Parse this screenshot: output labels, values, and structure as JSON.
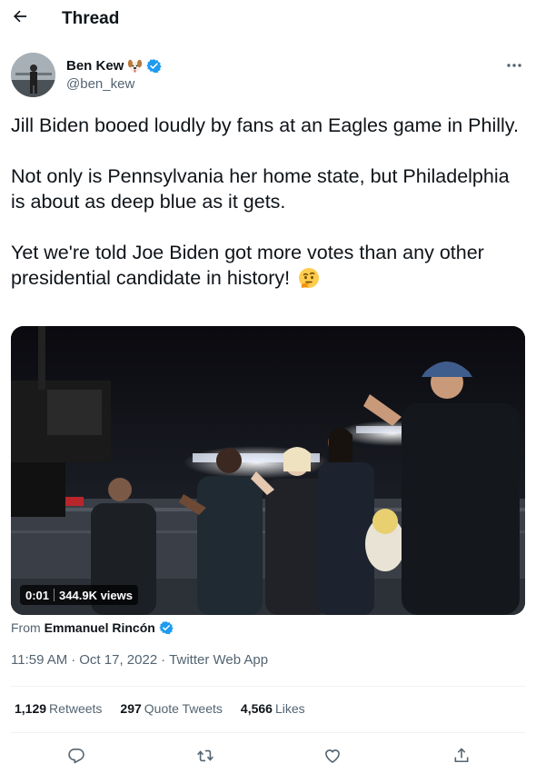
{
  "header": {
    "title": "Thread",
    "back_icon": "arrow-left-icon"
  },
  "author": {
    "name": "Ben Kew",
    "name_emoji": "dog-face-emoji",
    "verified_icon": "verified-badge-icon",
    "handle": "@ben_kew",
    "more_icon": "more-options-icon"
  },
  "tweet": {
    "paragraphs": [
      "Jill Biden booed loudly by fans at an Eagles game in Philly.",
      "Not only is Pennsylvania her home state, but Philadelphia is about as deep blue as it gets.",
      "Yet we're told Joe Biden got more votes than any other presidential candidate in history!"
    ],
    "trailing_emoji": "thinking-face-emoji"
  },
  "media": {
    "type": "video",
    "time": "0:01",
    "views": "344.9K views"
  },
  "attribution": {
    "prefix": "From",
    "name": "Emmanuel Rincón"
  },
  "meta": {
    "time": "11:59 AM",
    "separator": "·",
    "date": "Oct 17, 2022",
    "app": "Twitter Web App"
  },
  "stats": [
    {
      "count": "1,129",
      "label": "Retweets"
    },
    {
      "count": "297",
      "label": "Quote Tweets"
    },
    {
      "count": "4,566",
      "label": "Likes"
    }
  ],
  "actions": [
    "reply-icon",
    "retweet-icon",
    "like-icon",
    "share-icon"
  ],
  "colors": {
    "text": "#0f1419",
    "secondary": "#536471",
    "verified": "#1d9bf0",
    "divider": "#eff3f4"
  }
}
